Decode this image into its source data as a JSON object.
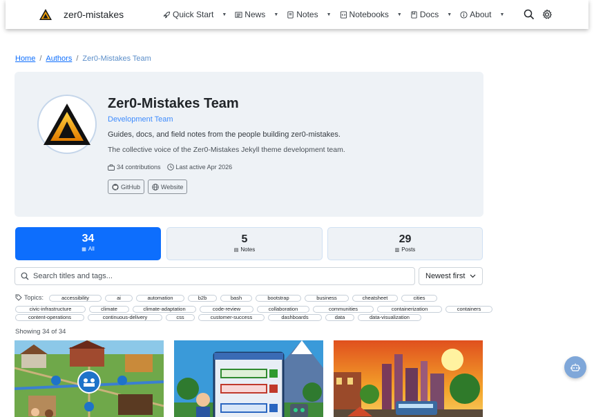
{
  "brand": {
    "name": "zer0-mistakes"
  },
  "nav": [
    {
      "label": "Quick Start",
      "icon": "rocket-icon",
      "dropdown": true
    },
    {
      "label": "News",
      "icon": "newspaper-icon",
      "dropdown": true
    },
    {
      "label": "Notes",
      "icon": "note-icon",
      "dropdown": true
    },
    {
      "label": "Notebooks",
      "icon": "code-file-icon",
      "dropdown": true
    },
    {
      "label": "Docs",
      "icon": "journal-icon",
      "dropdown": true
    },
    {
      "label": "About",
      "icon": "info-icon",
      "dropdown": true
    }
  ],
  "breadcrumb": {
    "home": "Home",
    "authors": "Authors",
    "current": "Zer0-Mistakes Team"
  },
  "profile": {
    "name": "Zer0-Mistakes Team",
    "role": "Development Team",
    "tagline": "Guides, docs, and field notes from the people building zer0-mistakes.",
    "description": "The collective voice of the Zer0-Mistakes Jekyll theme development team.",
    "contributions": "34 contributions",
    "last_active": "Last active Apr 2026",
    "links": [
      "GitHub",
      "Website"
    ]
  },
  "stats": [
    {
      "value": "34",
      "label": "All",
      "active": true
    },
    {
      "value": "5",
      "label": "Notes",
      "active": false
    },
    {
      "value": "29",
      "label": "Posts",
      "active": false
    }
  ],
  "search": {
    "placeholder": "Search titles and tags..."
  },
  "sort": {
    "selected": "Newest first"
  },
  "topics_label": "Topics:",
  "topics": [
    "accessibility",
    "ai",
    "automation",
    "b2b",
    "bash",
    "bootstrap",
    "business",
    "cheatsheet",
    "cities",
    "civic-infrastructure",
    "climate",
    "climate-adaptation",
    "code-review",
    "collaboration",
    "communities",
    "containerization",
    "containers",
    "content-operations",
    "continuous-delivery",
    "css",
    "customer-success",
    "dashboards",
    "data",
    "data-visualization"
  ],
  "showing": "Showing 34 of 34",
  "colors": {
    "primary": "#0d6efd",
    "card_bg": "#eef2f6",
    "link": "#0d6efd"
  }
}
